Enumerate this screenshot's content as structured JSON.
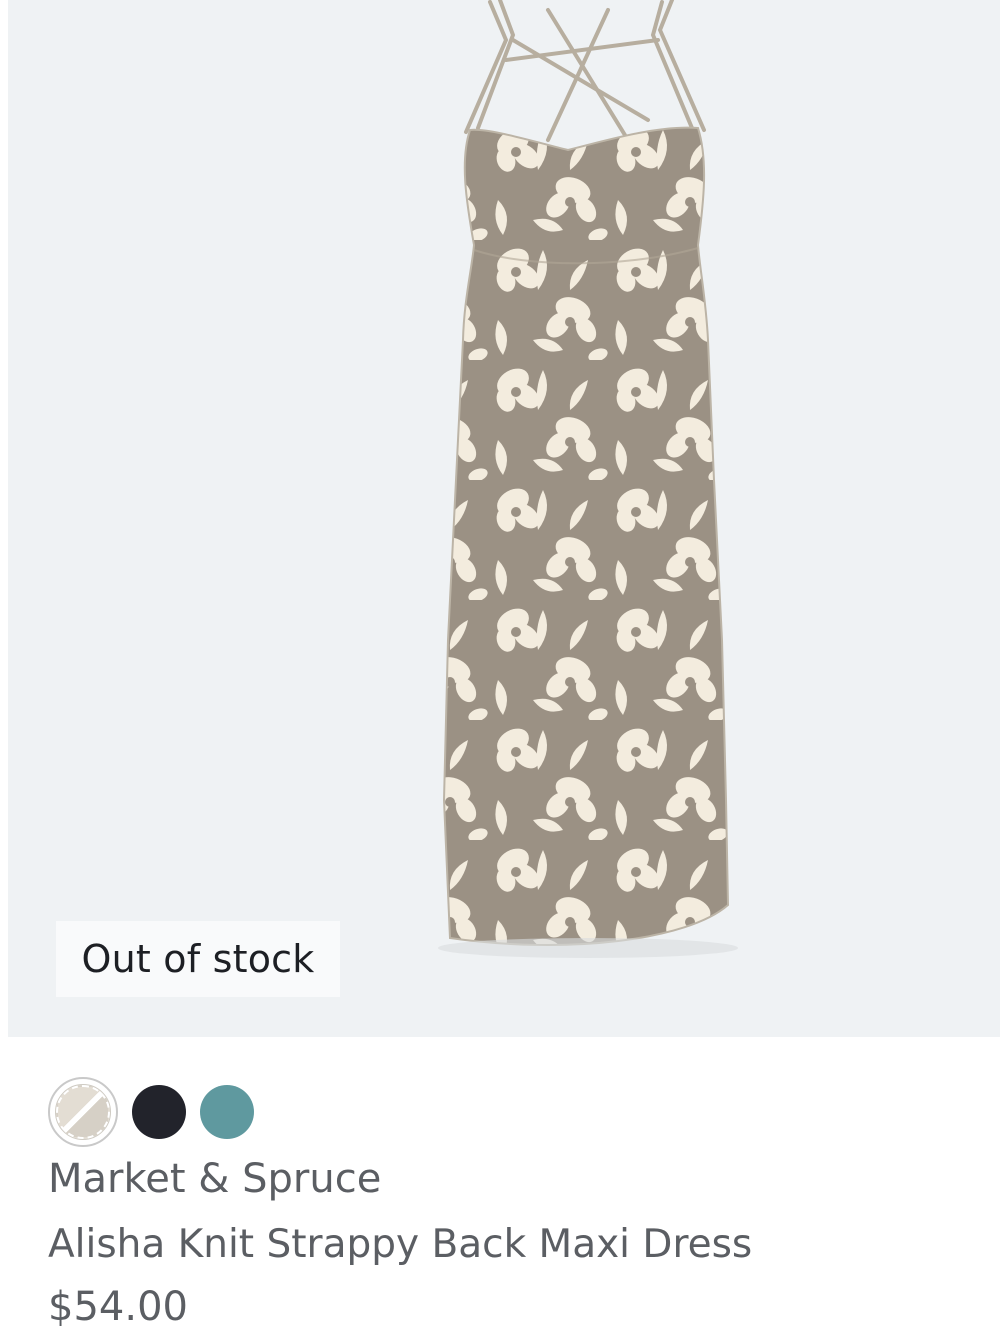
{
  "product": {
    "badge": "Out of stock",
    "brand": "Market & Spruce",
    "name": "Alisha Knit Strappy Back Maxi Dress",
    "price": "$54.00",
    "image_alt": "Alisha Knit Strappy Back Maxi Dress floral print",
    "swatches": [
      {
        "color": "#e3ddd3",
        "selected": true,
        "icon": "cream-floral-swatch"
      },
      {
        "color": "#22232b",
        "selected": false,
        "icon": "black-swatch"
      },
      {
        "color": "#5f999f",
        "selected": false,
        "icon": "teal-swatch"
      }
    ]
  },
  "colors": {
    "image_bg": "#eff2f4",
    "text": "#5b5e63",
    "dress_base": "#9b9184",
    "dress_flower": "#f3ecde"
  }
}
